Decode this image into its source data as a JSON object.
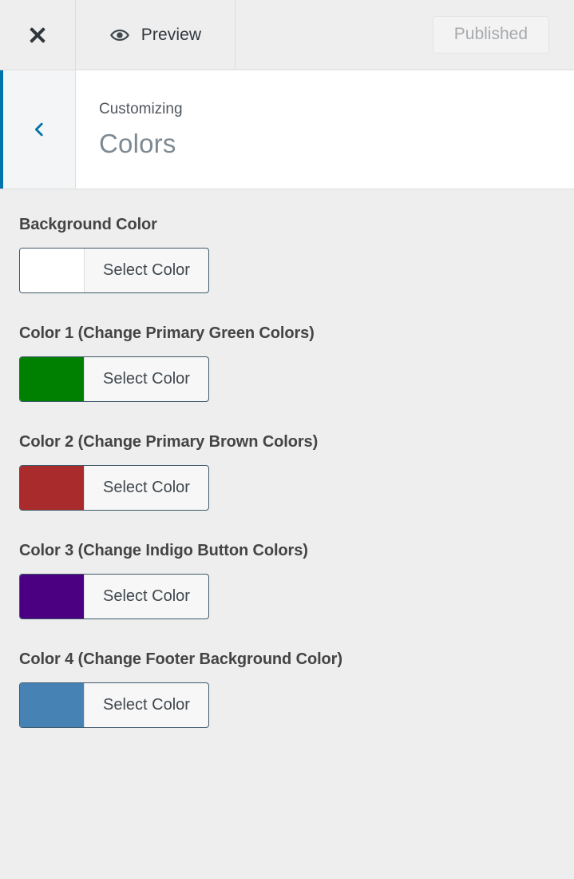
{
  "header": {
    "close_icon": "close-icon",
    "preview_icon": "eye-icon",
    "preview_label": "Preview",
    "publish_label": "Published"
  },
  "panel": {
    "back_icon": "chevron-left-icon",
    "kicker": "Customizing",
    "title": "Colors"
  },
  "controls": [
    {
      "label": "Background Color",
      "swatch": "#ffffff",
      "button_label": "Select Color"
    },
    {
      "label": "Color 1 (Change Primary Green Colors)",
      "swatch": "#008000",
      "button_label": "Select Color"
    },
    {
      "label": "Color 2 (Change Primary Brown Colors)",
      "swatch": "#a92b2b",
      "button_label": "Select Color"
    },
    {
      "label": "Color 3 (Change Indigo Button Colors)",
      "swatch": "#4b0082",
      "button_label": "Select Color"
    },
    {
      "label": "Color 4 (Change Footer Background Color)",
      "swatch": "#4682b4",
      "button_label": "Select Color"
    }
  ],
  "theme": {
    "accent": "#0073aa",
    "header_bg": "#eeeeee",
    "panel_bg": "#ffffff",
    "body_bg": "#eeeeee",
    "picker_border": "#3f5a6b"
  }
}
